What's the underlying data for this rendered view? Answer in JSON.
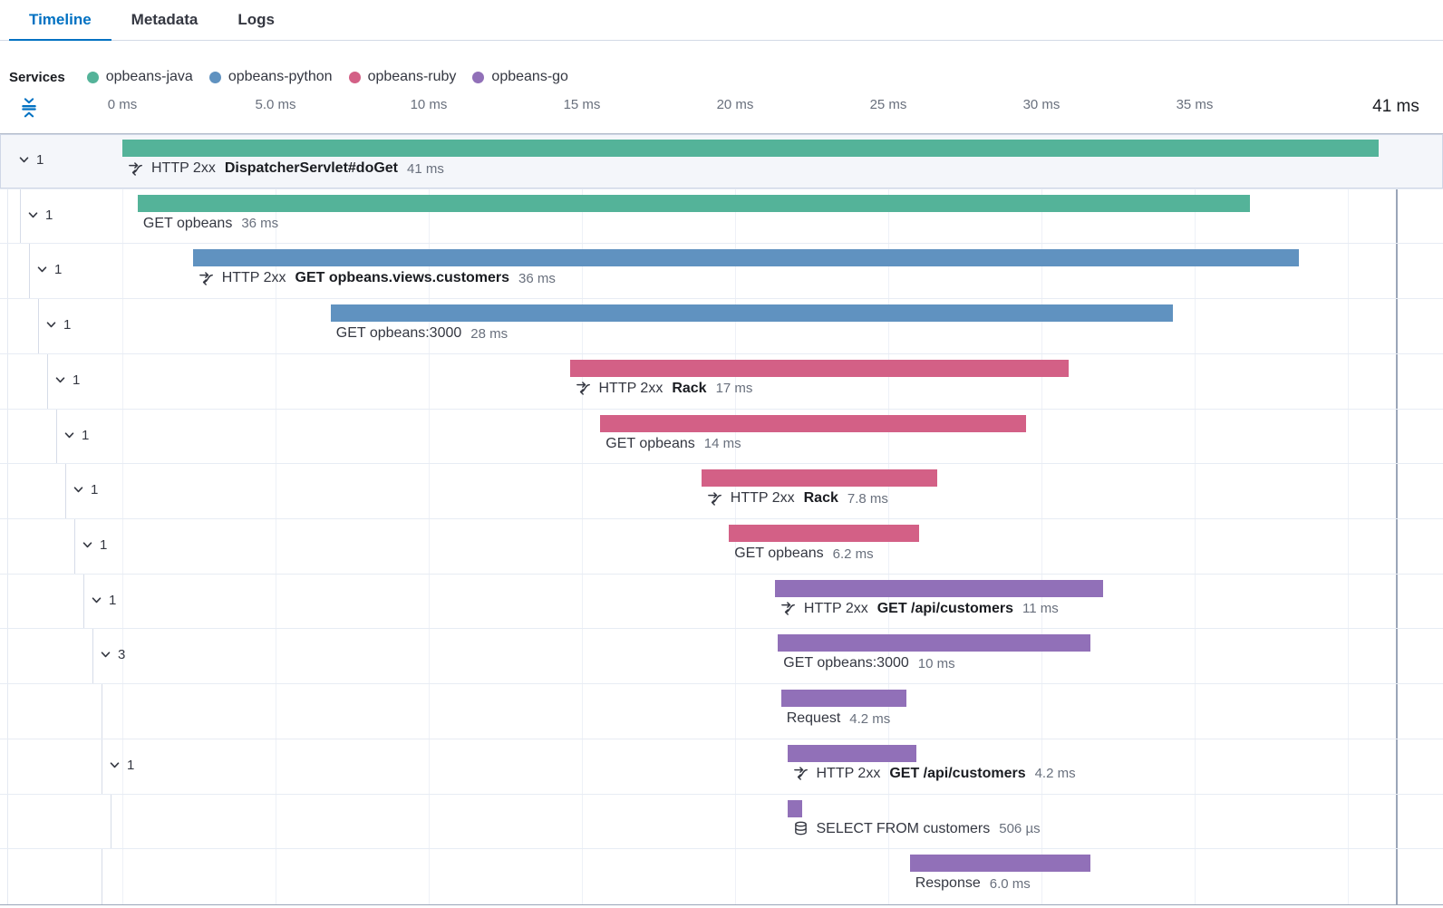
{
  "tabs": [
    {
      "label": "Timeline",
      "active": true
    },
    {
      "label": "Metadata",
      "active": false
    },
    {
      "label": "Logs",
      "active": false
    }
  ],
  "legend": {
    "title": "Services",
    "items": [
      {
        "name": "opbeans-java",
        "color": "#54B399"
      },
      {
        "name": "opbeans-python",
        "color": "#6092C0"
      },
      {
        "name": "opbeans-ruby",
        "color": "#D36086"
      },
      {
        "name": "opbeans-go",
        "color": "#9170B8"
      }
    ]
  },
  "chart_data": {
    "type": "waterfall",
    "unit": "ms",
    "xlim": [
      0,
      41
    ],
    "ticks": [
      {
        "label": "0 ms",
        "ms": 0
      },
      {
        "label": "5.0 ms",
        "ms": 5
      },
      {
        "label": "10 ms",
        "ms": 10
      },
      {
        "label": "15 ms",
        "ms": 15
      },
      {
        "label": "20 ms",
        "ms": 20
      },
      {
        "label": "25 ms",
        "ms": 25
      },
      {
        "label": "30 ms",
        "ms": 30
      },
      {
        "label": "35 ms",
        "ms": 35
      },
      {
        "label": "41 ms",
        "ms": 41,
        "end": true
      }
    ],
    "rows": [
      {
        "count": "1",
        "depth": 0,
        "service": "opbeans-java",
        "kind": "transaction",
        "prefix": "HTTP 2xx",
        "name": "DispatcherServlet#doGet",
        "duration": "41 ms",
        "start": 0,
        "dur": 41,
        "selected": true
      },
      {
        "count": "1",
        "depth": 1,
        "service": "opbeans-java",
        "kind": "span",
        "name": "GET opbeans",
        "duration": "36 ms",
        "start": 0.5,
        "dur": 36.3
      },
      {
        "count": "1",
        "depth": 2,
        "service": "opbeans-python",
        "kind": "transaction",
        "prefix": "HTTP 2xx",
        "name": "GET opbeans.views.customers",
        "duration": "36 ms",
        "start": 2.3,
        "dur": 36.1
      },
      {
        "count": "1",
        "depth": 3,
        "service": "opbeans-python",
        "kind": "span",
        "name": "GET opbeans:3000",
        "duration": "28 ms",
        "start": 6.8,
        "dur": 27.5
      },
      {
        "count": "1",
        "depth": 4,
        "service": "opbeans-ruby",
        "kind": "transaction",
        "prefix": "HTTP 2xx",
        "name": "Rack",
        "duration": "17 ms",
        "start": 14.6,
        "dur": 16.3
      },
      {
        "count": "1",
        "depth": 5,
        "service": "opbeans-ruby",
        "kind": "span",
        "name": "GET opbeans",
        "duration": "14 ms",
        "start": 15.6,
        "dur": 13.9
      },
      {
        "count": "1",
        "depth": 6,
        "service": "opbeans-ruby",
        "kind": "transaction",
        "prefix": "HTTP 2xx",
        "name": "Rack",
        "duration": "7.8 ms",
        "start": 18.9,
        "dur": 7.7
      },
      {
        "count": "1",
        "depth": 7,
        "service": "opbeans-ruby",
        "kind": "span",
        "name": "GET opbeans",
        "duration": "6.2 ms",
        "start": 19.8,
        "dur": 6.2
      },
      {
        "count": "1",
        "depth": 8,
        "service": "opbeans-go",
        "kind": "transaction",
        "prefix": "HTTP 2xx",
        "name": "GET /api/customers",
        "duration": "11 ms",
        "start": 21.3,
        "dur": 10.7
      },
      {
        "count": "3",
        "depth": 9,
        "service": "opbeans-go",
        "kind": "span",
        "name": "GET opbeans:3000",
        "duration": "10 ms",
        "start": 21.4,
        "dur": 10.2
      },
      {
        "depth": 10,
        "service": "opbeans-go",
        "kind": "span",
        "name": "Request",
        "duration": "4.2 ms",
        "start": 21.5,
        "dur": 4.1
      },
      {
        "count": "1",
        "depth": 10,
        "service": "opbeans-go",
        "kind": "transaction",
        "prefix": "HTTP 2xx",
        "name": "GET /api/customers",
        "duration": "4.2 ms",
        "start": 21.7,
        "dur": 4.2
      },
      {
        "depth": 11,
        "service": "opbeans-go",
        "kind": "span",
        "name": "SELECT FROM customers",
        "duration": "506 µs",
        "start": 21.7,
        "dur": 0.5,
        "icon": "database"
      },
      {
        "depth": 10,
        "service": "opbeans-go",
        "kind": "span",
        "name": "Response",
        "duration": "6.0 ms",
        "start": 25.7,
        "dur": 5.9
      }
    ]
  }
}
